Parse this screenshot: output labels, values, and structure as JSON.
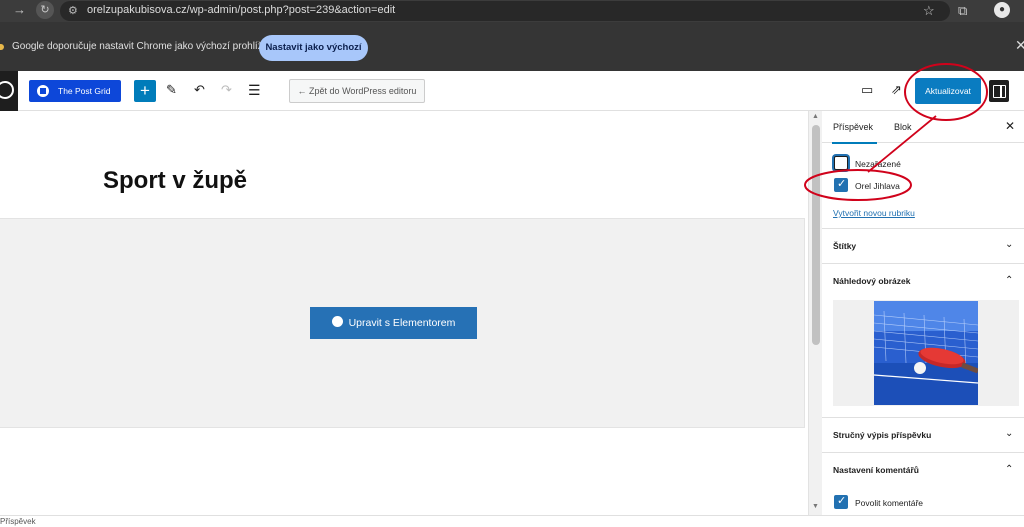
{
  "browser": {
    "url": "orelzupakubisova.cz/wp-admin/post.php?post=239&action=edit",
    "infobar_message": "Google doporučuje nastavit Chrome jako výchozí prohlížeč",
    "infobar_button": "Nastavit jako výchozí"
  },
  "toolbar": {
    "post_grid_label": "The Post Grid",
    "back_label": "← Zpět do WordPress editoru",
    "update_label": "Aktualizovat"
  },
  "editor": {
    "title": "Sport v župě",
    "elementor_button": "Upravit s Elementorem"
  },
  "sidebar": {
    "tabs": [
      "Příspěvek",
      "Blok"
    ],
    "categories": [
      {
        "label": "Nezařazené",
        "checked": false
      },
      {
        "label": "Orel Jihlava",
        "checked": true
      }
    ],
    "new_category_link": "Vytvořit novou rubriku",
    "panels": {
      "tags": "Štítky",
      "featured_image": "Náhledový obrázek",
      "excerpt": "Stručný výpis příspěvku",
      "discussion": "Nastavení komentářů"
    },
    "allow_comments": "Povolit komentáře"
  },
  "status": {
    "breadcrumb": "Příspěvek"
  },
  "colors": {
    "accent": "#007cba",
    "annotation": "#d0021b"
  }
}
